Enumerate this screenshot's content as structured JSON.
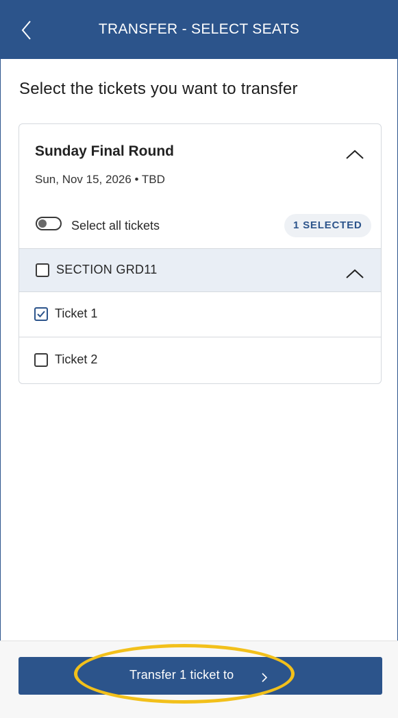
{
  "header": {
    "title": "TRANSFER - SELECT SEATS",
    "back_icon": "chevron-left-icon"
  },
  "page": {
    "heading": "Select the tickets you want to transfer"
  },
  "event": {
    "name": "Sunday Final Round",
    "date": "Sun, Nov 15, 2026 • TBD",
    "expanded": true
  },
  "select_all": {
    "label": "Select all tickets",
    "toggle_on": false
  },
  "selected_badge": "1 SELECTED",
  "section": {
    "label": "SECTION GRD11",
    "checked": false,
    "expanded": true
  },
  "tickets": [
    {
      "label": "Ticket 1",
      "checked": true
    },
    {
      "label": "Ticket 2",
      "checked": false
    }
  ],
  "transfer_button": {
    "label": "Transfer 1 ticket to",
    "icon": "chevron-right-icon"
  },
  "colors": {
    "brand": "#2c548b",
    "section_bg": "#e9eef5",
    "highlight": "#f2c01b"
  }
}
